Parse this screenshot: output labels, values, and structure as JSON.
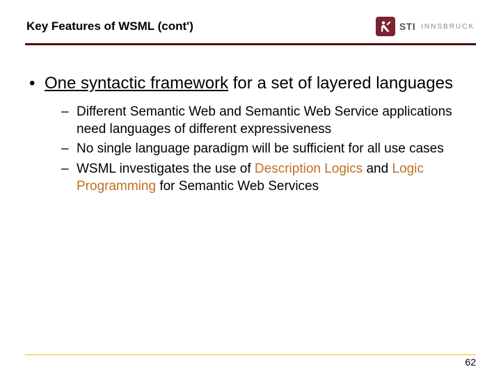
{
  "header": {
    "title": "Key Features of WSML (cont')",
    "logo": {
      "sti": "STI",
      "innsbruck": "INNSBRUCK"
    }
  },
  "main": {
    "bullet_underlined": "One syntactic framework",
    "bullet_rest": " for a set of layered languages",
    "sub": [
      {
        "text": "Different Semantic Web and Semantic Web Service applications need languages of different expressiveness"
      },
      {
        "text": "No single language paradigm will be sufficient for all use cases"
      },
      {
        "pre": "WSML investigates the use of ",
        "hl1": "Description Logics",
        "mid": " and ",
        "hl2": "Logic Programming",
        "post": " for Semantic Web Services"
      }
    ]
  },
  "footer": {
    "page": "62"
  }
}
